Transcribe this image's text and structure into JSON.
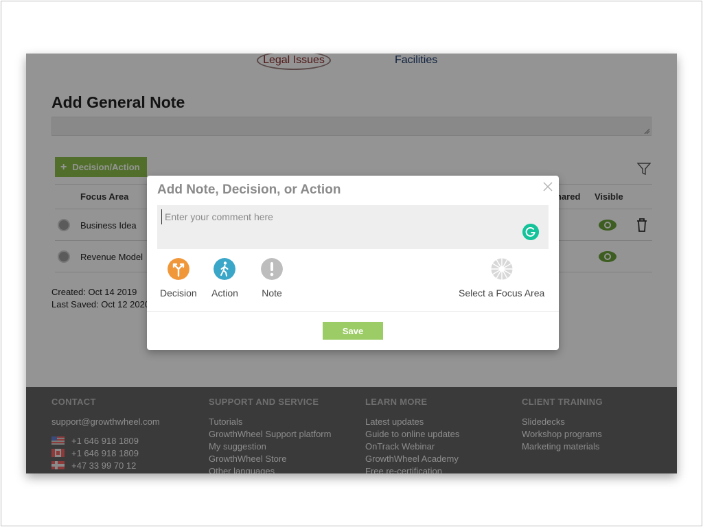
{
  "tabs": [
    {
      "label": "Legal Issues"
    },
    {
      "label": "Facilities"
    }
  ],
  "page": {
    "title": "Add General Note",
    "add_button_label": "Decision/Action",
    "table": {
      "headers": {
        "focus_area": "Focus Area",
        "shared": "hared",
        "visible": "Visible"
      },
      "rows": [
        {
          "focus_area": "Business Idea"
        },
        {
          "focus_area": "Revenue Model"
        }
      ]
    },
    "created": "Created: Oct 14 2019",
    "last_saved": "Last Saved: Oct 12 2020"
  },
  "modal": {
    "title": "Add Note, Decision, or Action",
    "comment_placeholder": "Enter your comment here",
    "types": [
      {
        "label": "Decision",
        "icon": "decision-icon",
        "color": "#f0973a"
      },
      {
        "label": "Action",
        "icon": "action-walk-icon",
        "color": "#3aa6c8"
      },
      {
        "label": "Note",
        "icon": "note-exclamation-icon",
        "color": "#bdbdbd"
      }
    ],
    "focus_area_label": "Select a Focus Area",
    "save_label": "Save"
  },
  "footer": {
    "contact": {
      "heading": "CONTACT",
      "email": "support@growthwheel.com",
      "phones": [
        {
          "flag": "us-flag-icon",
          "number": "+1 646 918 1809"
        },
        {
          "flag": "canada-flag-icon",
          "number": "+1 646 918 1809"
        },
        {
          "flag": "norway-flag-icon",
          "number": "+47 33 99 70 12"
        }
      ]
    },
    "support": {
      "heading": "SUPPORT AND SERVICE",
      "items": [
        "Tutorials",
        "GrowthWheel Support platform",
        "My suggestion",
        "GrowthWheel Store",
        "Other languages"
      ]
    },
    "learn": {
      "heading": "LEARN MORE",
      "items": [
        "Latest updates",
        "Guide to online updates",
        "OnTrack Webinar",
        "GrowthWheel Academy",
        "Free re-certification"
      ]
    },
    "training": {
      "heading": "CLIENT TRAINING",
      "items": [
        "Slidedecks",
        "Workshop programs",
        "Marketing materials"
      ]
    }
  },
  "colors": {
    "accent_green": "#8cc04a",
    "save_green": "#9ccc65",
    "footer_bg": "#3a3a3a",
    "eye_green": "#6aa039"
  }
}
